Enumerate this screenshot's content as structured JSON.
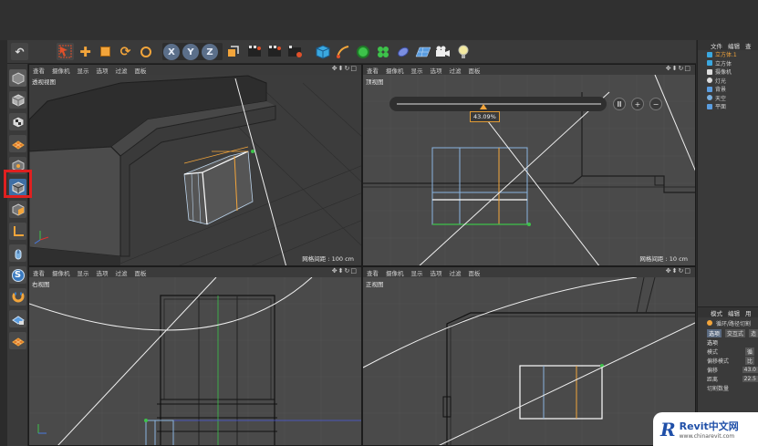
{
  "colors": {
    "accent": "#f3a53b",
    "highlight": "#e02020",
    "logo": "#1f4fa8"
  },
  "viewports": [
    {
      "label": "透视视图",
      "grid": "网格间距 : 100 cm"
    },
    {
      "label": "顶视图",
      "grid": "网格间距 : 10 cm"
    },
    {
      "label": "右视图",
      "grid": ""
    },
    {
      "label": "正视图",
      "grid": ""
    }
  ],
  "viewport_menu": [
    "查看",
    "摄像机",
    "显示",
    "选项",
    "过滤",
    "面板"
  ],
  "toolbar": {
    "undo": "↶",
    "x": "X",
    "y": "Y",
    "z": "Z"
  },
  "slider": {
    "percent": "43.09%",
    "fraction": 0.43
  },
  "object_panel": {
    "tabs": [
      "文件",
      "编辑",
      "查"
    ],
    "objects": [
      {
        "name": "立方体.1",
        "icon": "cube-icon",
        "color": "#3aa8e0",
        "selected": true
      },
      {
        "name": "立方体",
        "icon": "cube-icon",
        "color": "#3aa8e0",
        "selected": false
      },
      {
        "name": "摄像机",
        "icon": "camera-icon",
        "color": "#ddd",
        "selected": false
      },
      {
        "name": "灯光",
        "icon": "light-icon",
        "color": "#ddd",
        "selected": false
      },
      {
        "name": "背景",
        "icon": "background-icon",
        "color": "#5a9de0",
        "selected": false
      },
      {
        "name": "天空",
        "icon": "sky-icon",
        "color": "#7ab0e0",
        "selected": false
      },
      {
        "name": "平面",
        "icon": "plane-icon",
        "color": "#5a9de0",
        "selected": false
      }
    ]
  },
  "attr_panel": {
    "tabs": [
      "模式",
      "编辑",
      "用"
    ],
    "tool": "循环/路径切割",
    "subtabs": [
      "选项",
      "交互式",
      "造"
    ],
    "section": "选项",
    "rows": [
      {
        "label": "模式",
        "value": "循"
      },
      {
        "label": "偏移模式",
        "value": "比"
      },
      {
        "label": "偏移",
        "value": "43.0"
      },
      {
        "label": "距离",
        "value": "22.5"
      },
      {
        "label": "切割数量",
        "value": ""
      }
    ]
  },
  "logo": {
    "mark": "R",
    "name": "Revit中文网",
    "url": "www.chinarevit.com"
  }
}
